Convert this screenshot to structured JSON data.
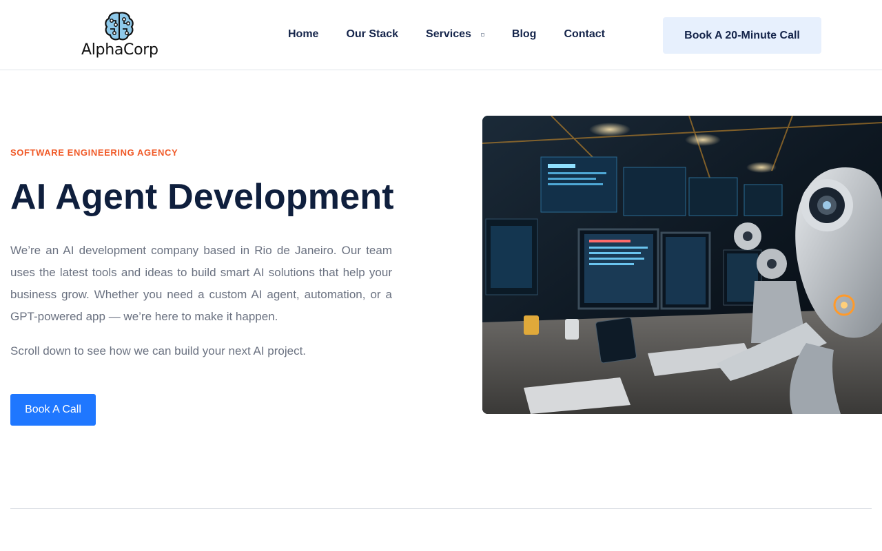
{
  "brand": {
    "name": "AlphaCorp",
    "icon": "brain-circuit-icon",
    "icon_color": "#8ec9ea"
  },
  "nav": {
    "items": [
      {
        "label": "Home"
      },
      {
        "label": "Our Stack"
      },
      {
        "label": "Services",
        "has_dropdown": true
      },
      {
        "label": "Blog"
      },
      {
        "label": "Contact"
      }
    ],
    "cta_label": "Book A 20-Minute Call"
  },
  "hero": {
    "eyebrow": "SOFTWARE ENGINEERING AGENCY",
    "title": "AI Agent Development",
    "description": "We’re an AI development company based in Rio de Janeiro. Our team uses the latest tools and ideas to build smart AI solutions that help your business grow. Whether you need a custom AI agent, automation, or a GPT-powered app — we’re here to make it happen.",
    "subtext": "Scroll down to see how we can build your next AI project.",
    "cta_label": "Book A Call",
    "image_subject": "robots working at computers in a futuristic lab"
  },
  "colors": {
    "accent": "#f05a28",
    "primary": "#1f77ff",
    "navy": "#0f1f3d",
    "cta_top_bg": "#e7f0fd",
    "body_text": "#6a7180"
  }
}
